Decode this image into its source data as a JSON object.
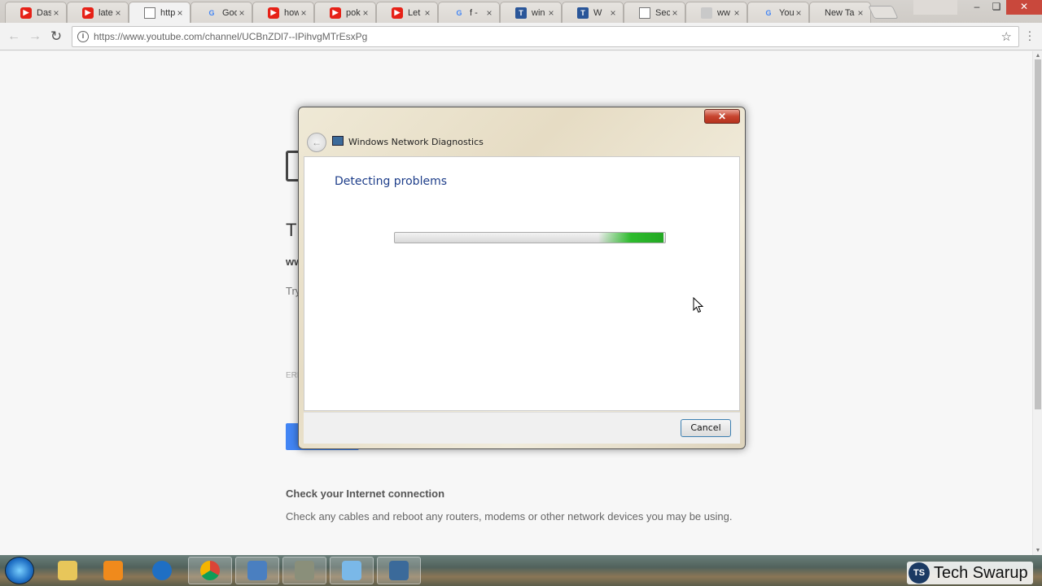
{
  "browser": {
    "tabs": [
      {
        "title": "Das",
        "icon": "youtube-icon",
        "active": false
      },
      {
        "title": "late",
        "icon": "youtube-icon",
        "active": false
      },
      {
        "title": "http",
        "icon": "page-icon",
        "active": true
      },
      {
        "title": "Goo",
        "icon": "google-icon",
        "active": false
      },
      {
        "title": "how",
        "icon": "youtube-icon",
        "active": false
      },
      {
        "title": "pok",
        "icon": "youtube-icon",
        "active": false
      },
      {
        "title": "Let",
        "icon": "youtube-icon",
        "active": false
      },
      {
        "title": "f - ",
        "icon": "google-icon",
        "active": false
      },
      {
        "title": "win",
        "icon": "t-icon",
        "active": false
      },
      {
        "title": "W",
        "icon": "t-icon",
        "active": false
      },
      {
        "title": "Sec",
        "icon": "page-icon",
        "active": false
      },
      {
        "title": "ww",
        "icon": "blank-icon",
        "active": false
      },
      {
        "title": "You",
        "icon": "google-icon",
        "active": false
      },
      {
        "title": "New Ta",
        "icon": "none",
        "active": false
      }
    ],
    "url": "https://www.youtube.com/channel/UCBnZDl7--IPihvgMTrEsxPg"
  },
  "error_page": {
    "title_fragment": "Th",
    "host_fragment": "ww",
    "try_fragment": "Try",
    "code_fragment": "ERR",
    "check_title": "Check your Internet connection",
    "check_body": "Check any cables and reboot any routers, modems or other network devices you may be using."
  },
  "dialog": {
    "close_label": "✕",
    "window_title": "Windows Network Diagnostics",
    "heading": "Detecting problems",
    "cancel_label": "Cancel"
  },
  "watermark": {
    "logo_text": "TS",
    "text": "Tech Swarup"
  },
  "colors": {
    "dialog_heading": "#1e3e8a",
    "progress_green": "#2dbb2d",
    "close_red": "#c7442f"
  }
}
